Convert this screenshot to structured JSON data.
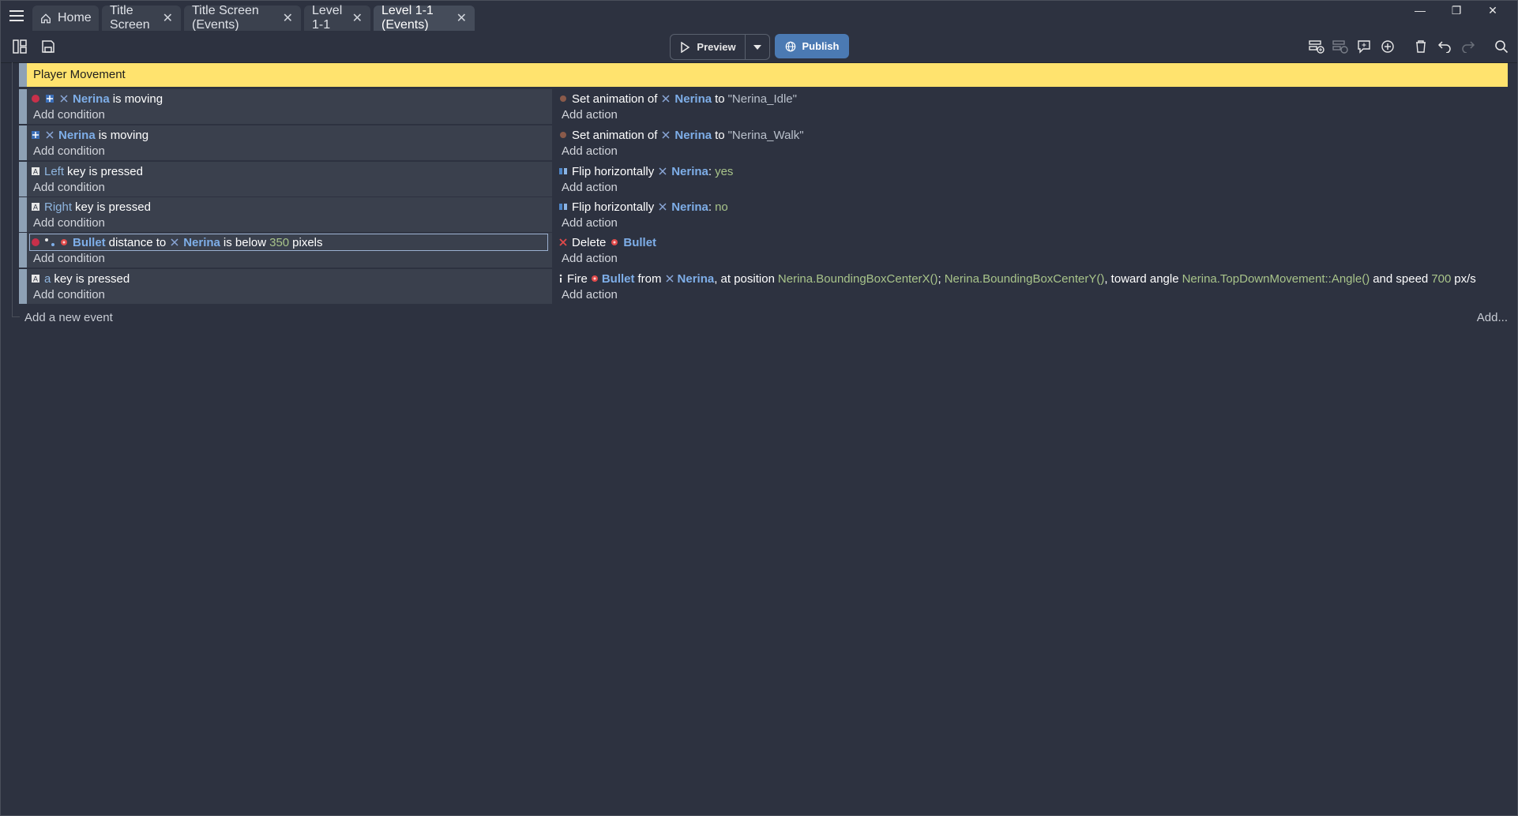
{
  "tabs": {
    "home": "Home",
    "items": [
      {
        "label": "Title Screen"
      },
      {
        "label": "Title Screen (Events)"
      },
      {
        "label": "Level 1-1"
      },
      {
        "label": "Level 1-1 (Events)"
      }
    ]
  },
  "toolbar": {
    "preview_label": "Preview",
    "publish_label": "Publish"
  },
  "group": {
    "title": "Player Movement"
  },
  "events": {
    "e1": {
      "cond": {
        "obj": "Nerina",
        "text": "is moving"
      },
      "act": {
        "text1": "Set animation of",
        "obj": "Nerina",
        "text2": "to",
        "value": "\"Nerina_Idle\""
      }
    },
    "e2": {
      "cond": {
        "obj": "Nerina",
        "text": "is moving"
      },
      "act": {
        "text1": "Set animation of",
        "obj": "Nerina",
        "text2": "to",
        "value": "\"Nerina_Walk\""
      }
    },
    "e3": {
      "cond": {
        "key": "Left",
        "text": "key is pressed"
      },
      "act": {
        "text1": "Flip horizontally",
        "obj": "Nerina",
        "text2": ":",
        "value": "yes"
      }
    },
    "e4": {
      "cond": {
        "key": "Right",
        "text": "key is pressed"
      },
      "act": {
        "text1": "Flip horizontally",
        "obj": "Nerina",
        "text2": ":",
        "value": "no"
      }
    },
    "e5": {
      "cond": {
        "obj1": "Bullet",
        "text1": "distance to",
        "obj2": "Nerina",
        "text2": "is below",
        "value": "350",
        "text3": "pixels"
      },
      "act": {
        "text1": "Delete",
        "obj": "Bullet"
      }
    },
    "e6": {
      "cond": {
        "key": "a",
        "text": "key is pressed"
      },
      "act": {
        "text1": "Fire",
        "obj1": "Bullet",
        "text2": "from",
        "obj2": "Nerina",
        "text3": ", at position",
        "expr1": "Nerina.BoundingBoxCenterX()",
        "sep": ";",
        "expr2": "Nerina.BoundingBoxCenterY()",
        "text4": ", toward angle",
        "expr3": "Nerina.TopDownMovement::Angle()",
        "text5": "and speed",
        "value": "700",
        "text6": "px/s"
      }
    }
  },
  "labels": {
    "add_condition": "Add condition",
    "add_action": "Add action",
    "add_event": "Add a new event",
    "add_more": "Add..."
  },
  "colors": {
    "background": "#2d3240",
    "group": "#ffe36e",
    "object": "#7eaee8",
    "value": "#a8c48a",
    "publish": "#4b7ab3"
  }
}
